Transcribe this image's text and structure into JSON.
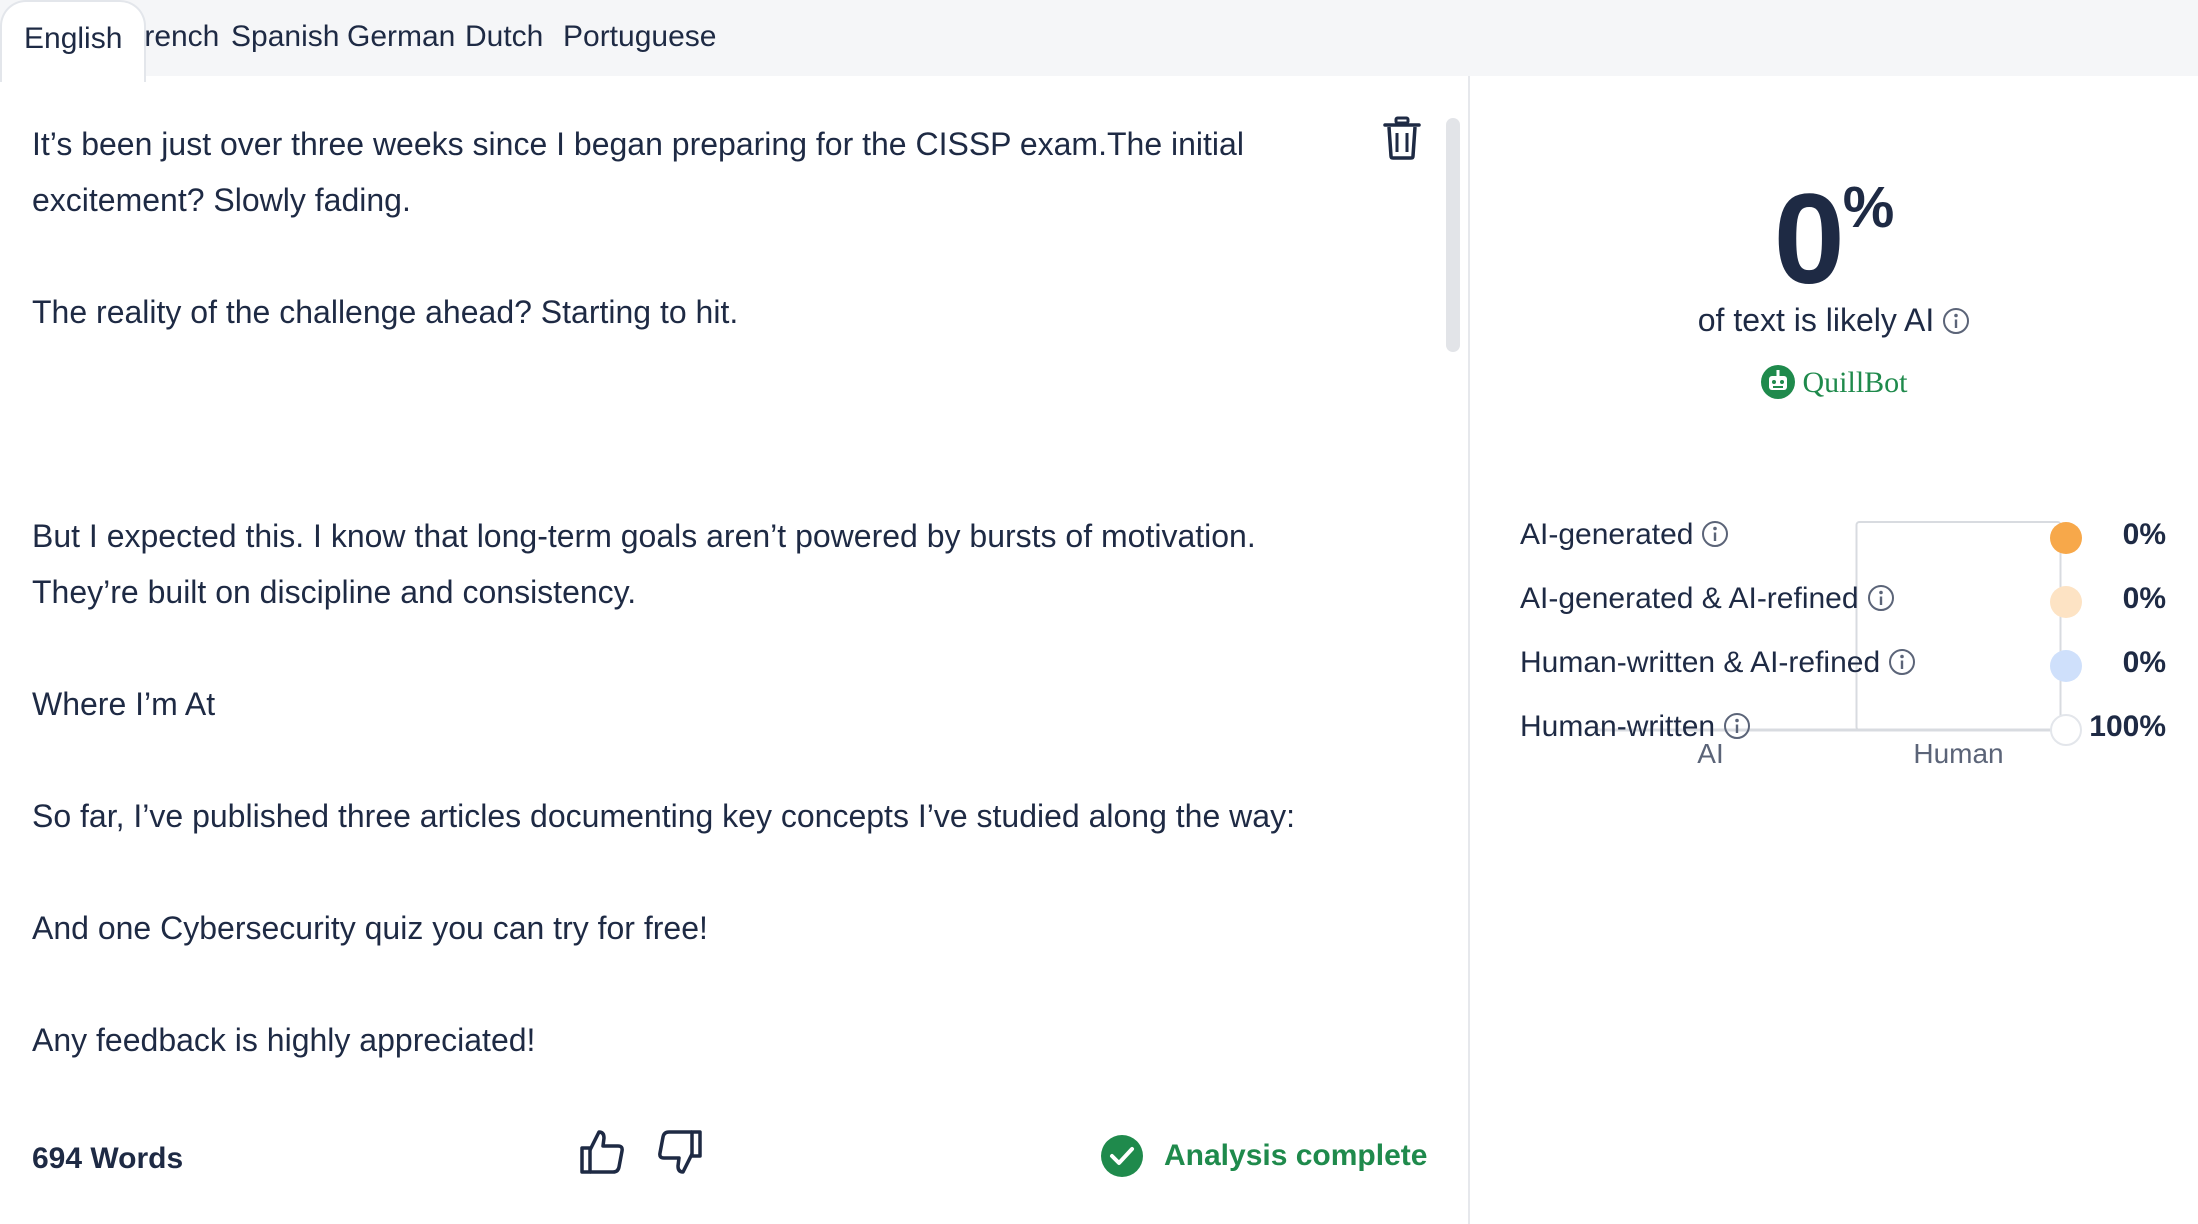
{
  "tabs": [
    {
      "label": "English",
      "active": true
    },
    {
      "label": "French"
    },
    {
      "label": "Spanish"
    },
    {
      "label": "German"
    },
    {
      "label": "Dutch"
    },
    {
      "label": "Portuguese"
    }
  ],
  "editor": {
    "paragraphs": [
      "It’s been just over three weeks since I began preparing for the CISSP exam.The initial excitement? Slowly fading.",
      "The reality of the challenge ahead? Starting to hit.",
      "But I expected this. I know that long-term goals aren’t powered by bursts of motivation. They’re built on discipline and consistency.",
      "Where I’m At",
      "So far, I’ve published three articles documenting key concepts I’ve studied along the way:",
      "And one Cybersecurity quiz you can try for free!",
      "Any feedback is highly appreciated!"
    ]
  },
  "footer": {
    "word_count": "694 Words",
    "status": "Analysis complete"
  },
  "result": {
    "percent": "0",
    "percent_sign": "%",
    "caption": "of text is likely AI",
    "brand": "QuillBot"
  },
  "chart_data": {
    "type": "bar",
    "categories": [
      "AI",
      "Human"
    ],
    "values": [
      0,
      100
    ],
    "ylim": [
      0,
      100
    ],
    "grid": false,
    "legend": "none"
  },
  "legend": [
    {
      "label": "AI-generated",
      "value": "0%",
      "color": "#f7a84a"
    },
    {
      "label": "AI-generated & AI-refined",
      "value": "0%",
      "color": "#fde3c4"
    },
    {
      "label": "Human-written & AI-refined",
      "value": "0%",
      "color": "#cfe0fb"
    },
    {
      "label": "Human-written",
      "value": "100%",
      "color": "#ffffff"
    }
  ],
  "colors": {
    "accent_green": "#1f8a4c",
    "text_dark": "#1e2a44"
  }
}
